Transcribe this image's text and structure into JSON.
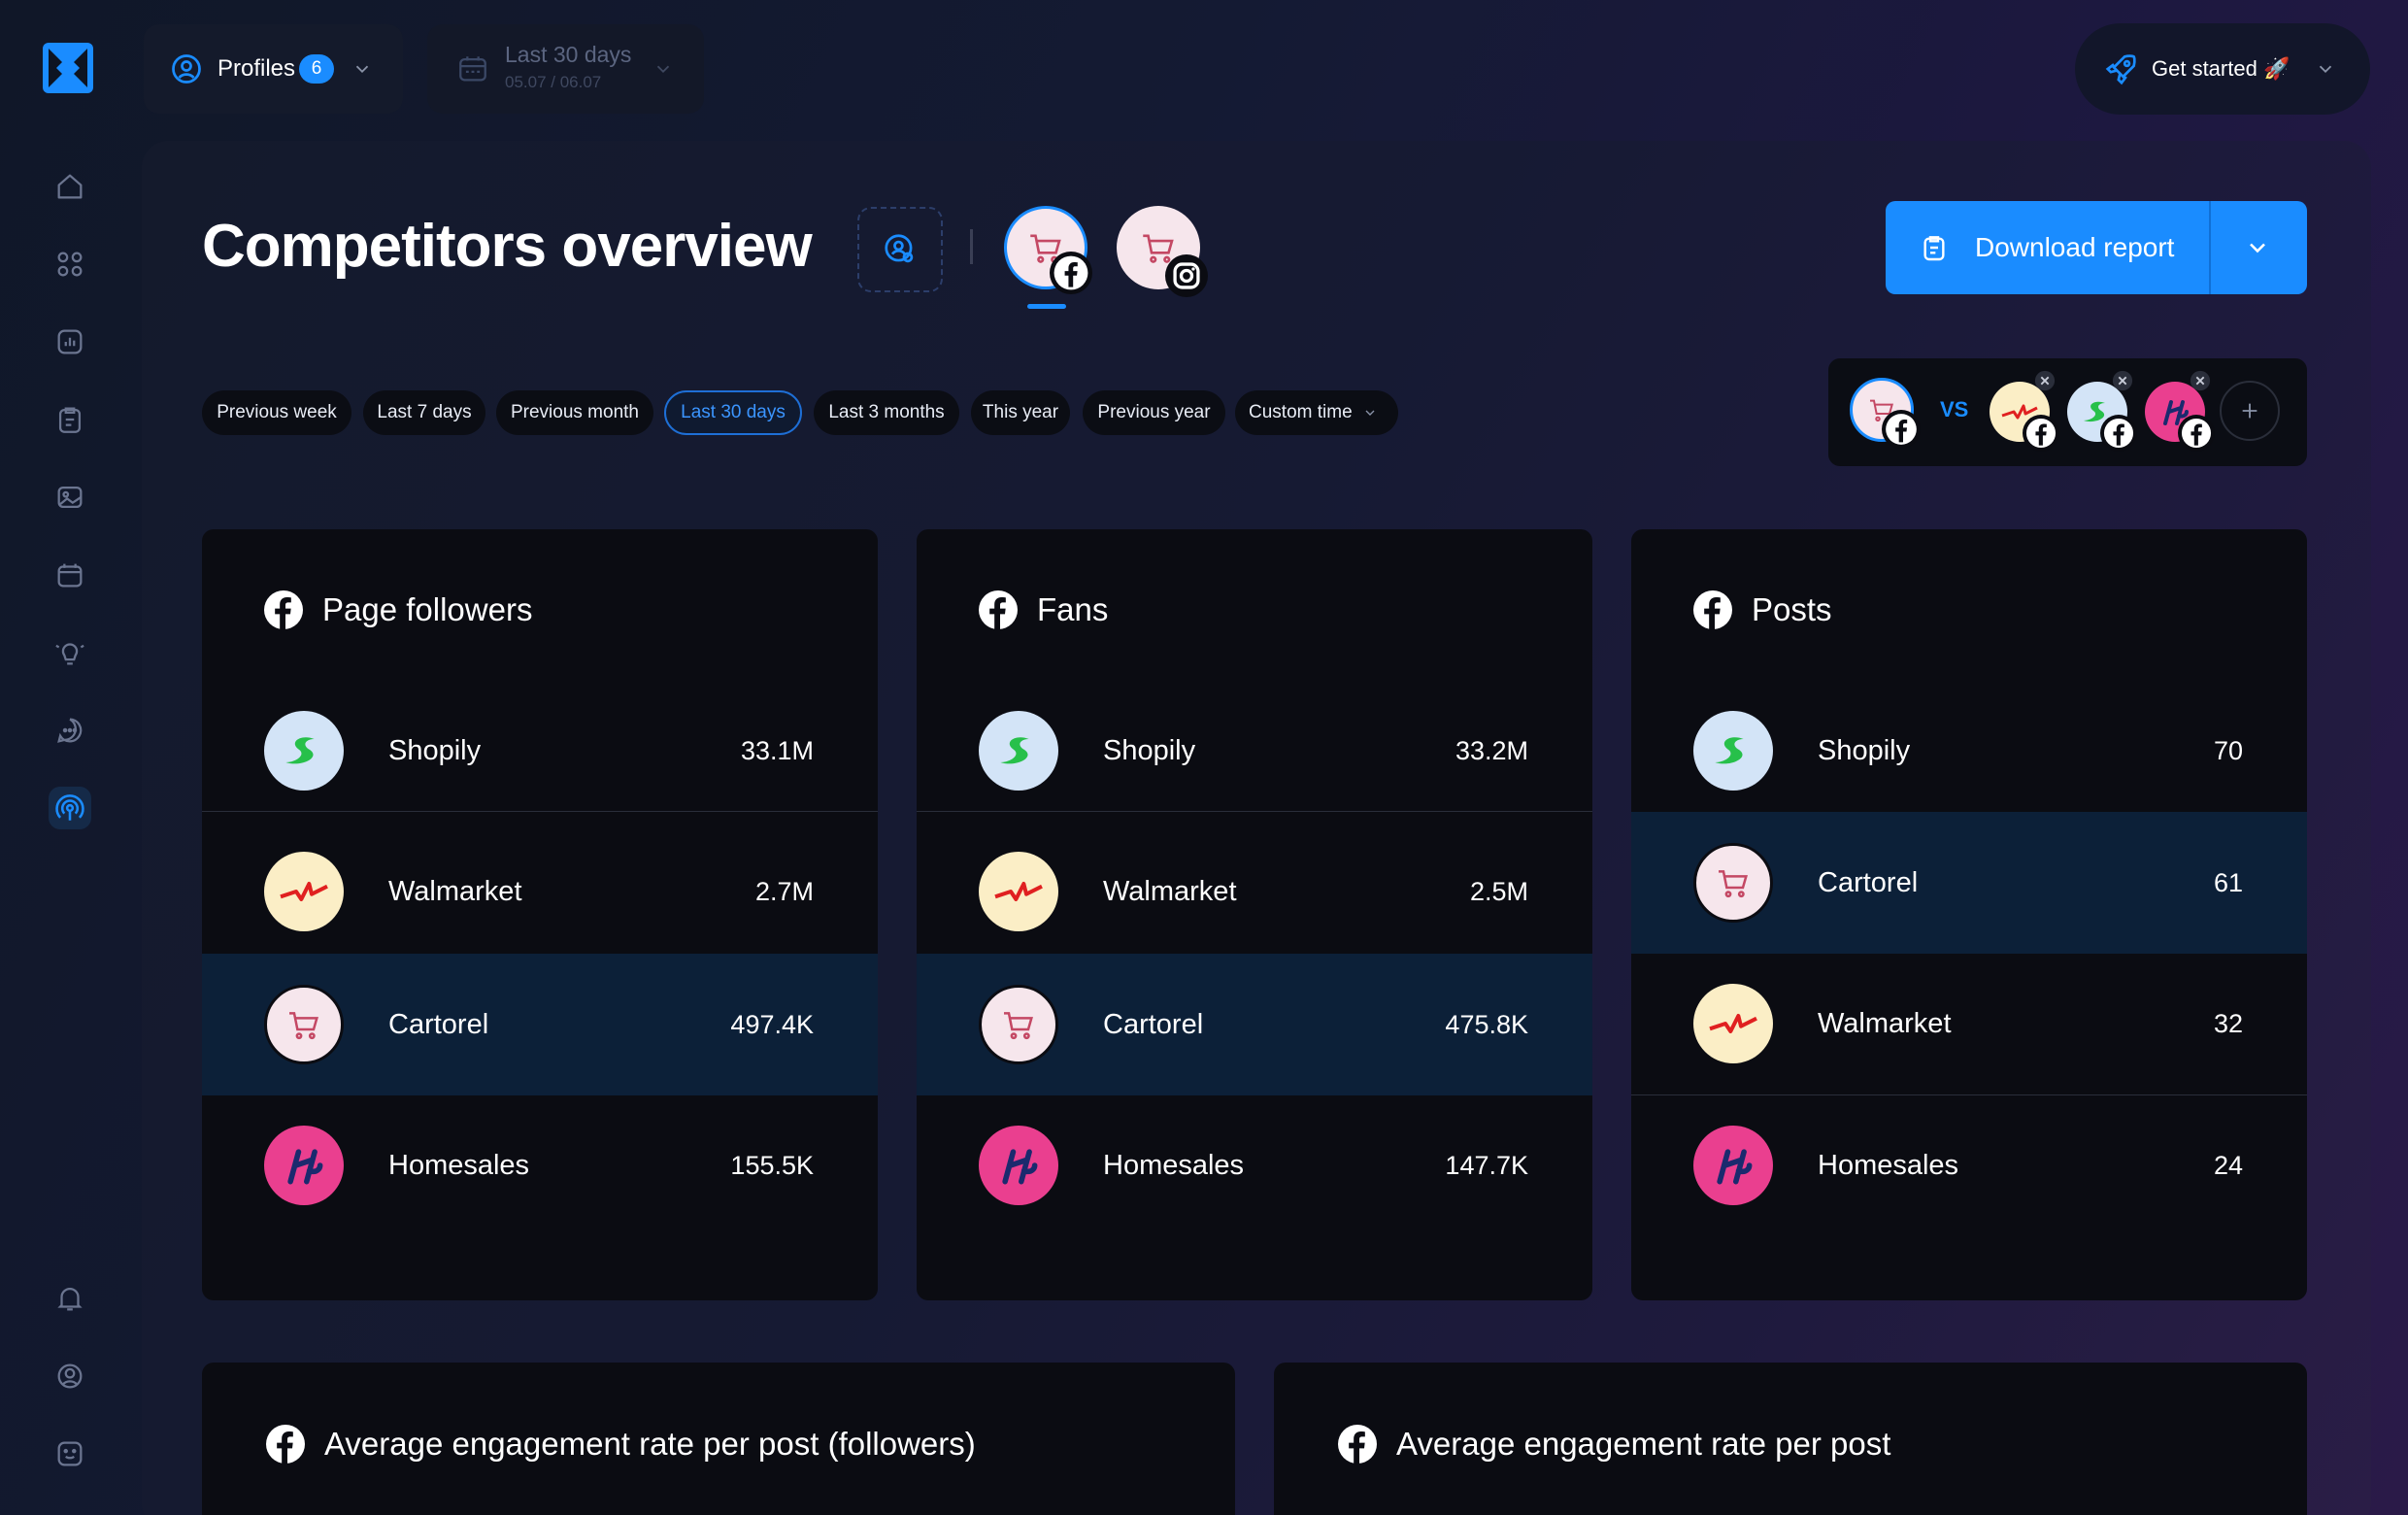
{
  "colors": {
    "accent": "#1a8cff",
    "highlight_row": "#0c2038",
    "card_bg": "#0b0c12"
  },
  "topbar": {
    "profiles_label": "Profiles",
    "profiles_count": "6",
    "date_label": "Last 30 days",
    "date_range": "05.07 / 06.07",
    "get_started": "Get started 🚀"
  },
  "page": {
    "title": "Competitors overview",
    "download_label": "Download report"
  },
  "filters": [
    "Previous week",
    "Last 7 days",
    "Previous month",
    "Last 30 days",
    "Last 3 months",
    "This year",
    "Previous year",
    "Custom time"
  ],
  "active_filter": "Last 30 days",
  "compare": {
    "vs_label": "VS"
  },
  "cards": [
    {
      "title": "Page followers",
      "rows": [
        {
          "name": "Shopily",
          "value": "33.1M"
        },
        {
          "name": "Walmarket",
          "value": "2.7M"
        },
        {
          "name": "Cartorel",
          "value": "497.4K"
        },
        {
          "name": "Homesales",
          "value": "155.5K"
        }
      ]
    },
    {
      "title": "Fans",
      "rows": [
        {
          "name": "Shopily",
          "value": "33.2M"
        },
        {
          "name": "Walmarket",
          "value": "2.5M"
        },
        {
          "name": "Cartorel",
          "value": "475.8K"
        },
        {
          "name": "Homesales",
          "value": "147.7K"
        }
      ]
    },
    {
      "title": "Posts",
      "rows": [
        {
          "name": "Shopily",
          "value": "70"
        },
        {
          "name": "Cartorel",
          "value": "61"
        },
        {
          "name": "Walmarket",
          "value": "32"
        },
        {
          "name": "Homesales",
          "value": "24"
        }
      ]
    }
  ],
  "bottom_cards": [
    {
      "title": "Average engagement rate per post (followers)"
    },
    {
      "title": "Average engagement rate per post"
    }
  ]
}
